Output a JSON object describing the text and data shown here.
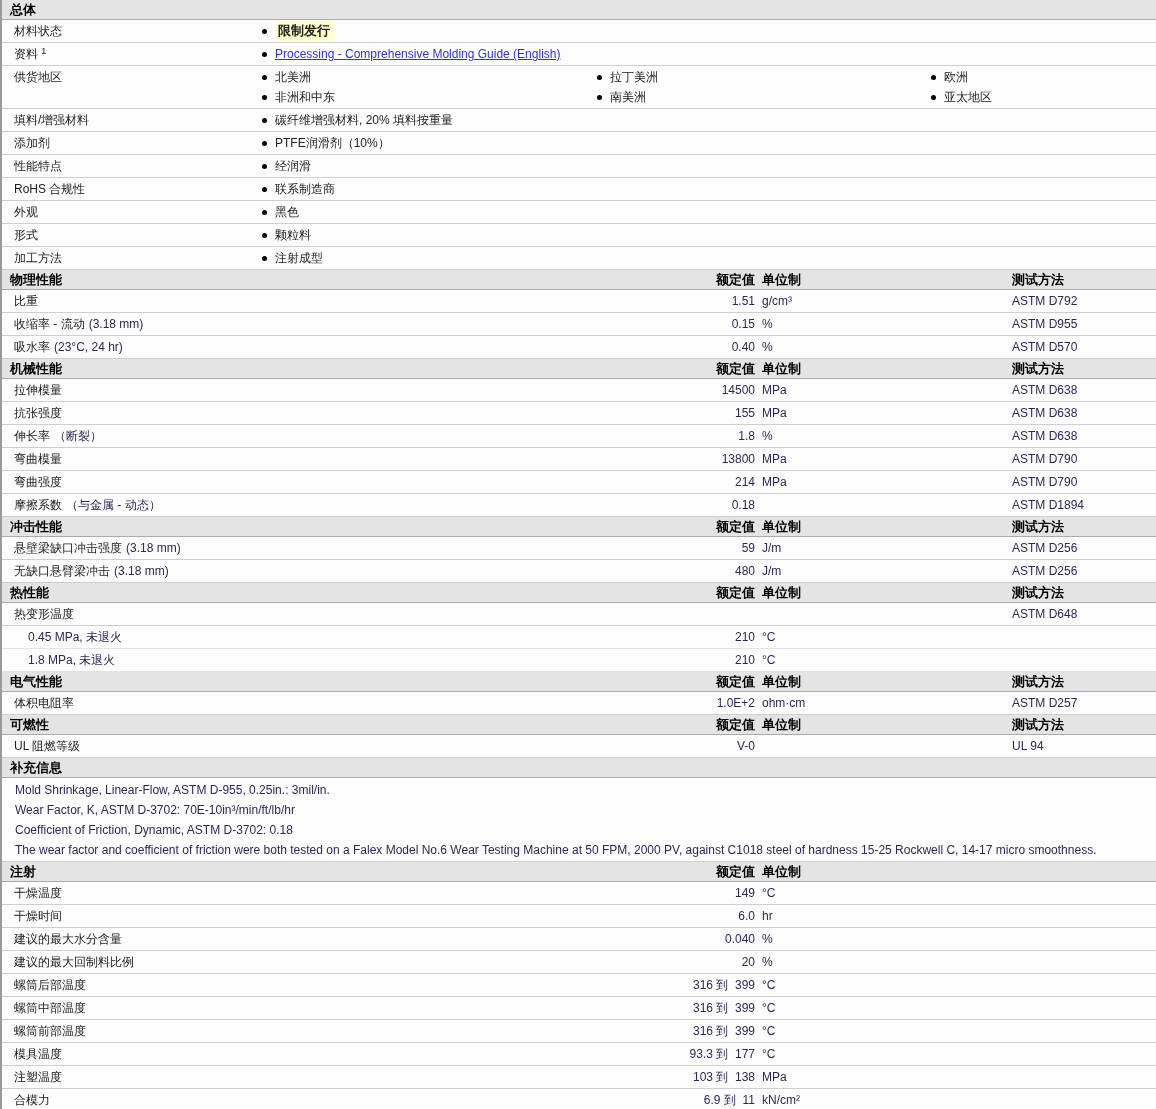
{
  "sections": [
    {
      "kind": "overview",
      "title": "总体",
      "rows": [
        {
          "kind": "list",
          "label": "材料状态",
          "items": [
            {
              "kind": "status",
              "text": "限制发行"
            }
          ]
        },
        {
          "kind": "list",
          "label": "资料 $^{1}$",
          "items": [
            {
              "kind": "link",
              "text": "Processing - Comprehensive Molding Guide (English)"
            }
          ]
        },
        {
          "kind": "columns",
          "label": "供货地区",
          "items": [
            {
              "kind": "text",
              "text": "北美洲"
            },
            {
              "kind": "text",
              "text": "拉丁美洲"
            },
            {
              "kind": "text",
              "text": "欧洲"
            },
            {
              "kind": "text",
              "text": "非洲和中东"
            },
            {
              "kind": "text",
              "text": "南美洲"
            },
            {
              "kind": "text",
              "text": "亚太地区"
            }
          ]
        },
        {
          "kind": "list",
          "label": "填料/增强材料",
          "items": [
            {
              "kind": "text",
              "text": "碳纤维增强材料, 20% 填料按重量"
            }
          ]
        },
        {
          "kind": "list",
          "label": "添加剂",
          "items": [
            {
              "kind": "text",
              "text": "PTFE润滑剂（10%）"
            }
          ]
        },
        {
          "kind": "list",
          "label": "性能特点",
          "items": [
            {
              "kind": "text",
              "text": "经润滑"
            }
          ]
        },
        {
          "kind": "list",
          "label": "RoHS 合规性",
          "items": [
            {
              "kind": "text",
              "text": "联系制造商"
            }
          ]
        },
        {
          "kind": "list",
          "label": "外观",
          "items": [
            {
              "kind": "text",
              "text": "黑色"
            }
          ]
        },
        {
          "kind": "list",
          "label": "形式",
          "items": [
            {
              "kind": "text",
              "text": "颗粒料"
            }
          ]
        },
        {
          "kind": "list",
          "label": "加工方法",
          "items": [
            {
              "kind": "text",
              "text": "注射成型"
            }
          ]
        }
      ]
    },
    {
      "kind": "properties",
      "title": "物理性能",
      "columns": [
        "额定值",
        "单位制",
        "测试方法"
      ],
      "rows": [
        {
          "label": "比重",
          "value": "1.51",
          "unit": "g/cm³",
          "method": "ASTM D792"
        },
        {
          "label": "收缩率 - 流动",
          "note": "(3.18 mm)",
          "value": "0.15",
          "unit": "%",
          "method": "ASTM D955"
        },
        {
          "label": "吸水率",
          "note": "(23°C, 24 hr)",
          "value": "0.40",
          "unit": "%",
          "method": "ASTM D570"
        }
      ]
    },
    {
      "kind": "properties",
      "title": "机械性能",
      "columns": [
        "额定值",
        "单位制",
        "测试方法"
      ],
      "rows": [
        {
          "label": "拉伸模量",
          "value": "14500",
          "unit": "MPa",
          "method": "ASTM D638"
        },
        {
          "label": "抗张强度",
          "value": "155",
          "unit": "MPa",
          "method": "ASTM D638"
        },
        {
          "label": "伸长率",
          "note": "（断裂）",
          "value": "1.8",
          "unit": "%",
          "method": "ASTM D638"
        },
        {
          "label": "弯曲模量",
          "value": "13800",
          "unit": "MPa",
          "method": "ASTM D790"
        },
        {
          "label": "弯曲强度",
          "value": "214",
          "unit": "MPa",
          "method": "ASTM D790"
        },
        {
          "label": "摩擦系数",
          "note": "（与金属 - 动态）",
          "value": "0.18",
          "method": "ASTM D1894"
        }
      ]
    },
    {
      "kind": "properties",
      "title": "冲击性能",
      "columns": [
        "额定值",
        "单位制",
        "测试方法"
      ],
      "rows": [
        {
          "label": "悬壁梁缺口冲击强度",
          "note": "(3.18 mm)",
          "value": "59",
          "unit": "J/m",
          "method": "ASTM D256"
        },
        {
          "label": "无缺口悬臂梁冲击",
          "note": "(3.18 mm)",
          "value": "480",
          "unit": "J/m",
          "method": "ASTM D256"
        }
      ]
    },
    {
      "kind": "properties",
      "title": "热性能",
      "columns": [
        "额定值",
        "单位制",
        "测试方法"
      ],
      "rows": [
        {
          "label": "热变形温度",
          "method": "ASTM D648",
          "children": [
            {
              "label": "0.45 MPa, 未退火",
              "value": "210",
              "unit": "°C"
            },
            {
              "label": "1.8 MPa, 未退火",
              "value": "210",
              "unit": "°C"
            }
          ]
        }
      ]
    },
    {
      "kind": "properties",
      "title": "电气性能",
      "columns": [
        "额定值",
        "单位制",
        "测试方法"
      ],
      "rows": [
        {
          "label": "体积电阻率",
          "value": "1.0E+2",
          "unit": "ohm·cm",
          "method": "ASTM D257"
        }
      ]
    },
    {
      "kind": "properties",
      "title": "可燃性",
      "columns": [
        "额定值",
        "单位制",
        "测试方法"
      ],
      "rows": [
        {
          "label": "UL 阻燃等级",
          "value": "V-0",
          "method": "UL 94"
        }
      ]
    },
    {
      "kind": "notes",
      "title": "补充信息",
      "lines": [
        "Mold Shrinkage, Linear-Flow, ASTM D-955, 0.25in.: 3mil/in.",
        "Wear Factor, K, ASTM D-3702: 70E-10in³/min/ft/lb/hr",
        "Coefficient of Friction, Dynamic, ASTM D-3702: 0.18",
        "The wear factor and coefficient of friction were both tested on a Falex Model No.6 Wear Testing Machine at 50 FPM, 2000 PV, against C1018 steel of hardness 15-25 Rockwell C, 14-17 micro smoothness."
      ]
    },
    {
      "kind": "properties",
      "title": "注射",
      "columns": [
        "额定值",
        "单位制"
      ],
      "rows": [
        {
          "label": "干燥温度",
          "value": "149",
          "unit": "°C"
        },
        {
          "label": "干燥时间",
          "value": "6.0",
          "unit": "hr"
        },
        {
          "label": "建议的最大水分含量",
          "value": "0.040",
          "unit": "%"
        },
        {
          "label": "建议的最大回制料比例",
          "value": "20",
          "unit": "%"
        },
        {
          "label": "螺筒后部温度",
          "value": "316 到  399",
          "unit": "°C"
        },
        {
          "label": "螺筒中部温度",
          "value": "316 到  399",
          "unit": "°C"
        },
        {
          "label": "螺筒前部温度",
          "value": "316 到  399",
          "unit": "°C"
        },
        {
          "label": "模具温度",
          "value": "93.3 到  177",
          "unit": "°C"
        },
        {
          "label": "注塑温度",
          "value": "103 到  138",
          "unit": "MPa"
        },
        {
          "label": "合模力",
          "value": "6.9 到  11",
          "unit": "kN/cm²"
        }
      ]
    }
  ]
}
